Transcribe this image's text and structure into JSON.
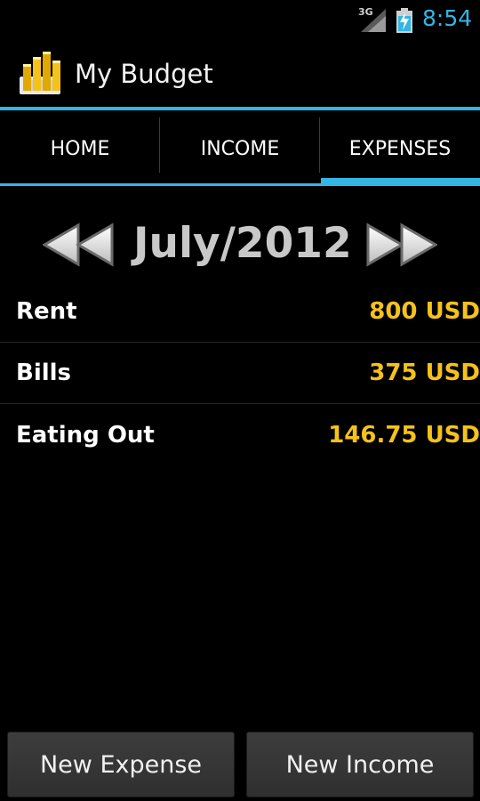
{
  "status_bar": {
    "network": "3G",
    "time": "8:54",
    "accent_color": "#33b5e5",
    "icons": [
      "signal-icon",
      "battery-charging-icon"
    ]
  },
  "action_bar": {
    "app_title": "My Budget",
    "icon": "budget-coins-icon"
  },
  "tabs": [
    {
      "label": "HOME",
      "selected": false
    },
    {
      "label": "INCOME",
      "selected": false
    },
    {
      "label": "EXPENSES",
      "selected": true
    }
  ],
  "month_nav": {
    "label": "July/2012",
    "prev_icon": "rewind-icon",
    "next_icon": "fast-forward-icon"
  },
  "expenses": [
    {
      "name": "Rent",
      "amount": "800 USD"
    },
    {
      "name": "Bills",
      "amount": "375 USD"
    },
    {
      "name": "Eating Out",
      "amount": "146.75 USD"
    }
  ],
  "buttons": {
    "new_expense": "New Expense",
    "new_income": "New Income"
  },
  "colors": {
    "amount": "#f4c21a",
    "accent": "#33b5e5",
    "month_label": "#c8c8c8"
  }
}
